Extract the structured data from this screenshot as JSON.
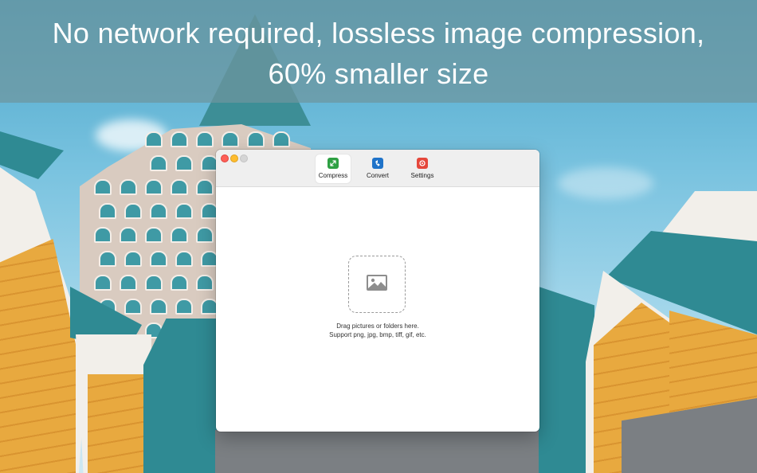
{
  "banner": {
    "line1": "No network required, lossless image compression,",
    "line2": "60% smaller size"
  },
  "window": {
    "toolbar": [
      {
        "label": "Compress",
        "icon": "compress-icon",
        "color": "#2ea043"
      },
      {
        "label": "Convert",
        "icon": "convert-icon",
        "color": "#1f73c9"
      },
      {
        "label": "Settings",
        "icon": "settings-icon",
        "color": "#e5473b"
      }
    ],
    "drop": {
      "icon": "image-icon",
      "line1": "Drag pictures or folders here.",
      "line2": "Support png, jpg, bmp, tiff, gif, etc."
    }
  },
  "colors": {
    "banner_overlay": "#6e969e",
    "roof_teal": "#2f8a93",
    "wall_orange": "#e7a53c"
  }
}
